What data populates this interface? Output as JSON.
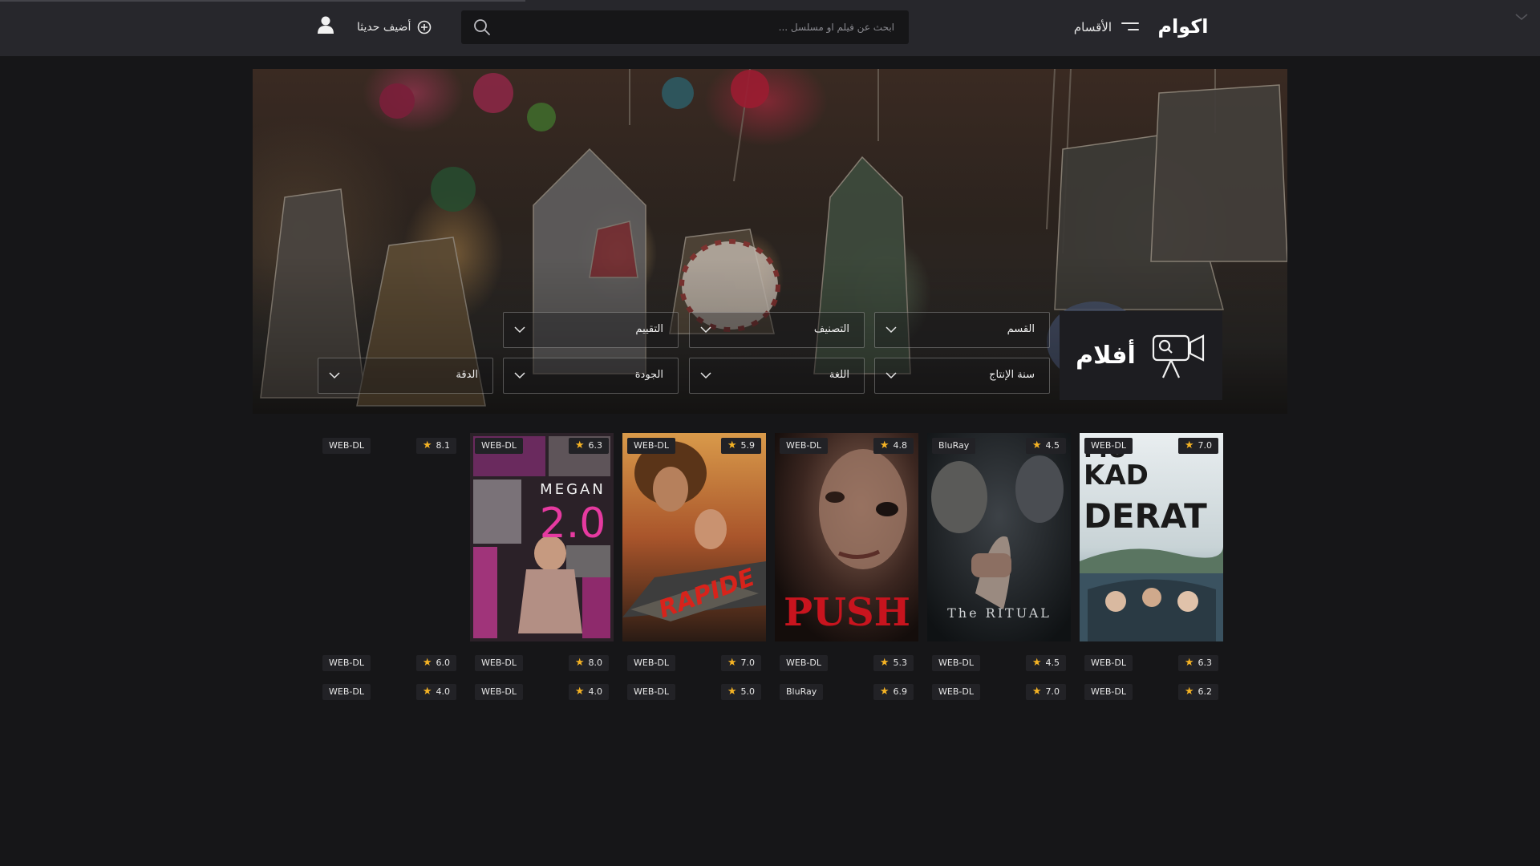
{
  "header": {
    "logo_text": "اكوام",
    "menu_label": "الأقسام",
    "search_placeholder": "ابحث عن فيلم او مسلسل ...",
    "add_recent_label": "أضيف حديثا"
  },
  "section": {
    "title": "أفلام",
    "filters": [
      "القسم",
      "التصنيف",
      "التقييم",
      "سنة الإنتاج",
      "اللغة",
      "الجودة",
      "الدقة"
    ]
  },
  "movies_row1": [
    {
      "title": "MUKADDERAT",
      "quality": "WEB-DL",
      "rating": "7.0"
    },
    {
      "title": "THE RITUAL",
      "quality": "BluRay",
      "rating": "4.5"
    },
    {
      "title": "PUSH",
      "quality": "WEB-DL",
      "rating": "4.8"
    },
    {
      "title": "RAPIDE",
      "quality": "WEB-DL",
      "rating": "5.9"
    },
    {
      "title": "MEGAN 2.0",
      "quality": "WEB-DL",
      "rating": "6.3"
    },
    {
      "title": "",
      "quality": "WEB-DL",
      "rating": "8.1"
    }
  ],
  "movies_row2": [
    {
      "quality": "WEB-DL",
      "rating": "6.3"
    },
    {
      "quality": "WEB-DL",
      "rating": "4.5"
    },
    {
      "quality": "WEB-DL",
      "rating": "5.3"
    },
    {
      "quality": "WEB-DL",
      "rating": "7.0"
    },
    {
      "quality": "WEB-DL",
      "rating": "8.0"
    },
    {
      "quality": "WEB-DL",
      "rating": "6.0"
    }
  ],
  "movies_row3": [
    {
      "quality": "WEB-DL",
      "rating": "6.2"
    },
    {
      "quality": "WEB-DL",
      "rating": "7.0"
    },
    {
      "quality": "BluRay",
      "rating": "6.9"
    },
    {
      "quality": "WEB-DL",
      "rating": "5.0"
    },
    {
      "quality": "WEB-DL",
      "rating": "4.0"
    },
    {
      "quality": "WEB-DL",
      "rating": "4.0"
    }
  ],
  "poster_lettering": {
    "mukadderat": [
      "MU",
      "KAD",
      "DERAT"
    ],
    "ritual": "The RITUAL",
    "push": "PUSH",
    "rapide": "RAPIDE",
    "megan": [
      "MEGAN",
      "2.0"
    ]
  },
  "colors": {
    "background": "#161618",
    "header": "#27272c",
    "star": "#f5b324",
    "tag": "#222226"
  },
  "icons": [
    "menu-icon",
    "search-icon",
    "plus-circle-icon",
    "user-icon",
    "chevron-down-icon",
    "movie-camera-icon",
    "star-icon"
  ]
}
